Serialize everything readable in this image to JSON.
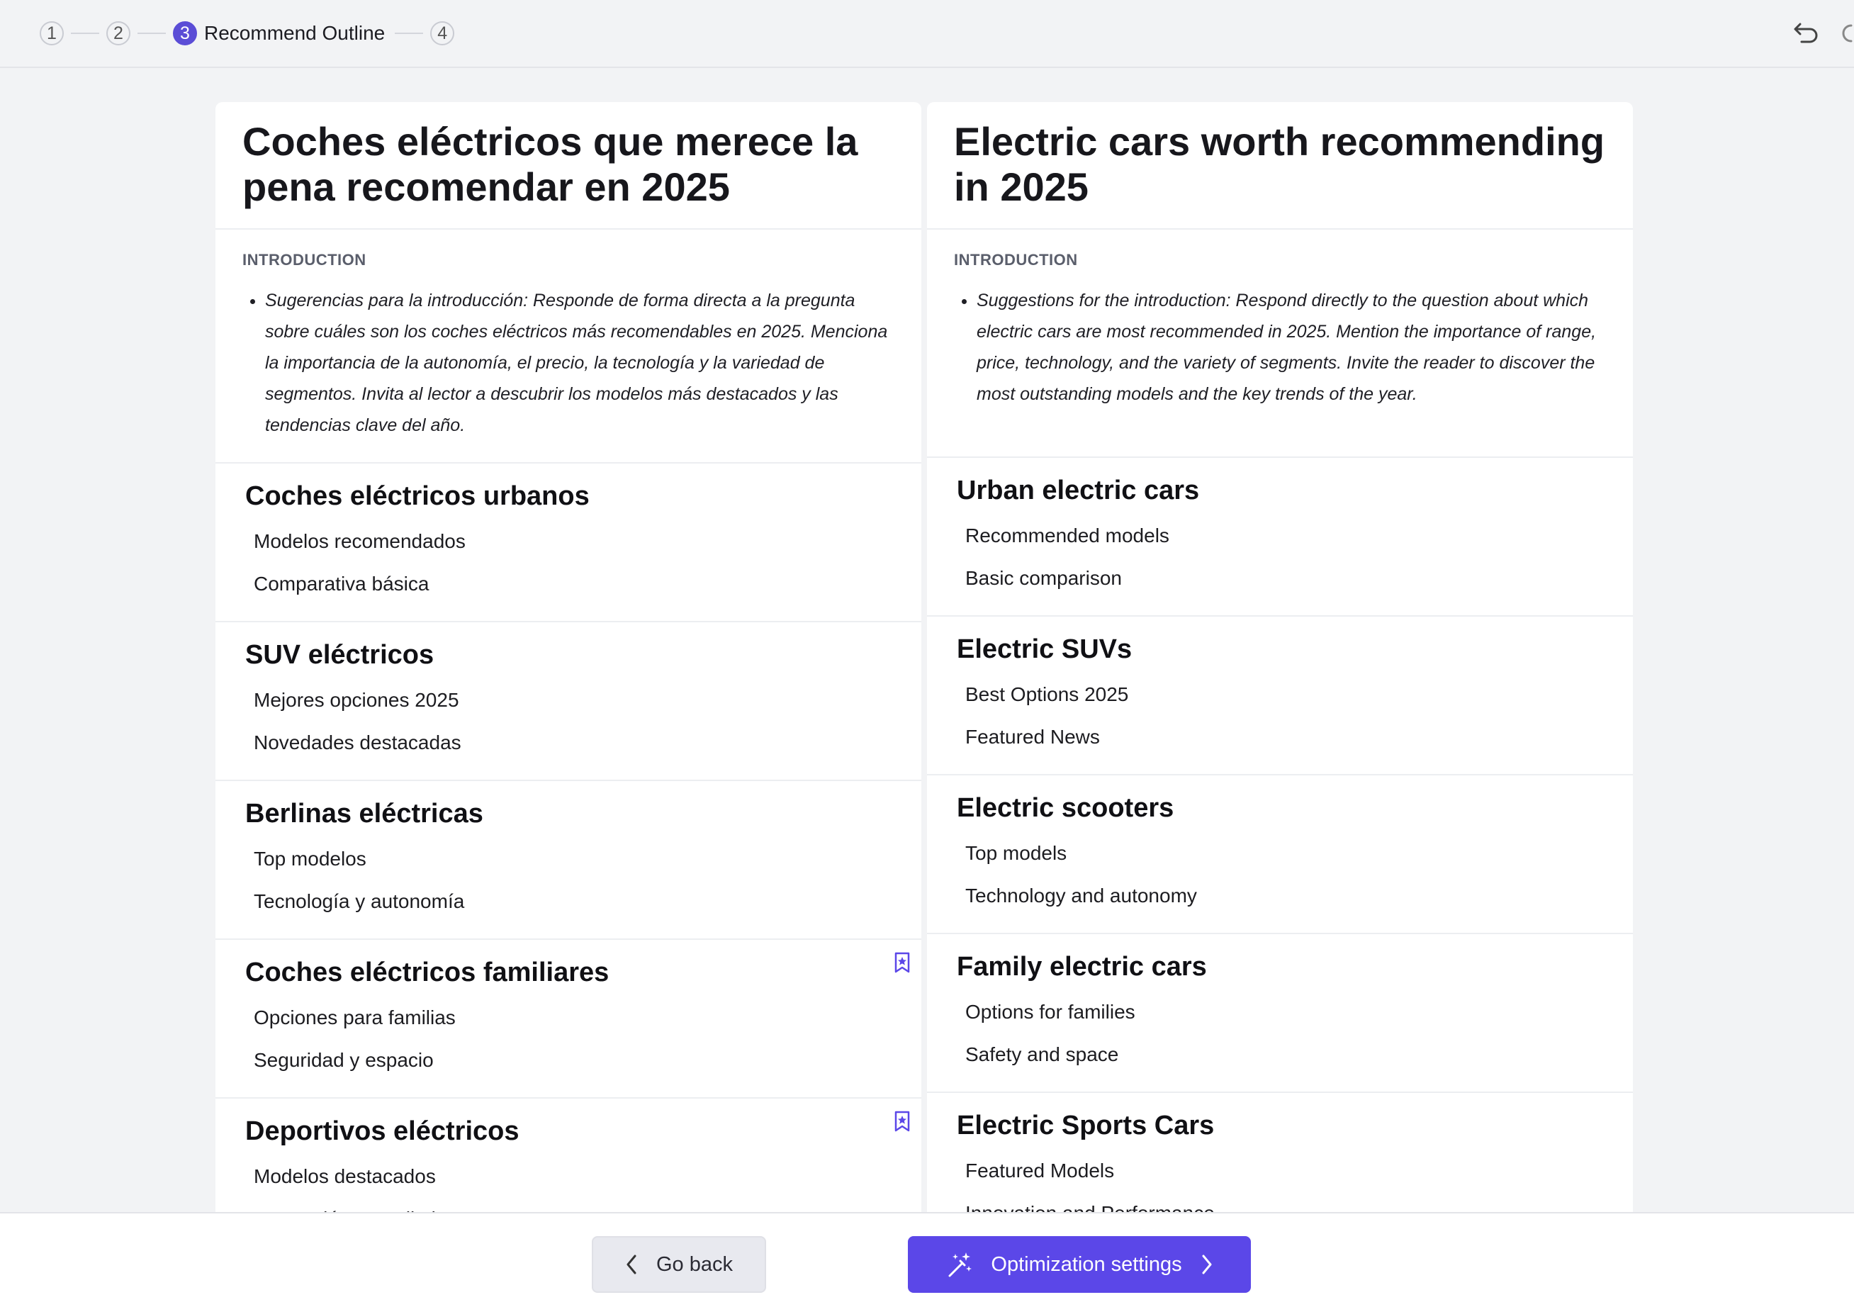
{
  "stepper": {
    "steps": [
      {
        "number": "1",
        "label": ""
      },
      {
        "number": "2",
        "label": ""
      },
      {
        "number": "3",
        "label": "Recommend Outline"
      },
      {
        "number": "4",
        "label": ""
      }
    ],
    "active_step": 3
  },
  "toolbar": {
    "undo_icon": "undo-icon",
    "redo_icon": "redo-icon"
  },
  "columns": [
    {
      "title": "Coches eléctricos que merece la pena recomendar en 2025",
      "intro_label": "INTRODUCTION",
      "intro_text": "Sugerencias para la introducción: Responde de forma directa a la pregunta sobre cuáles son los coches eléctricos más recomendables en 2025. Menciona la importancia de la autonomía, el precio, la tecnología y la variedad de segmentos. Invita al lector a descubrir los modelos más destacados y las tendencias clave del año.",
      "sections": [
        {
          "heading": "Coches eléctricos urbanos",
          "items": [
            "Modelos recomendados",
            "Comparativa básica"
          ],
          "bookmarked": false
        },
        {
          "heading": "SUV eléctricos",
          "items": [
            "Mejores opciones 2025",
            "Novedades destacadas"
          ],
          "bookmarked": false
        },
        {
          "heading": "Berlinas eléctricas",
          "items": [
            "Top modelos",
            "Tecnología y autonomía"
          ],
          "bookmarked": false
        },
        {
          "heading": "Coches eléctricos familiares",
          "items": [
            "Opciones para familias",
            "Seguridad y espacio"
          ],
          "bookmarked": true
        },
        {
          "heading": "Deportivos eléctricos",
          "items": [
            "Modelos destacados",
            "Innovación y rendimiento"
          ],
          "bookmarked": true
        }
      ]
    },
    {
      "title": "Electric cars worth recommending in 2025",
      "intro_label": "INTRODUCTION",
      "intro_text": "Suggestions for the introduction: Respond directly to the question about which electric cars are most recommended in 2025. Mention the importance of range, price, technology, and the variety of segments. Invite the reader to discover the most outstanding models and the key trends of the year.",
      "sections": [
        {
          "heading": "Urban electric cars",
          "items": [
            "Recommended models",
            "Basic comparison"
          ],
          "bookmarked": false
        },
        {
          "heading": "Electric SUVs",
          "items": [
            "Best Options 2025",
            "Featured News"
          ],
          "bookmarked": false
        },
        {
          "heading": "Electric scooters",
          "items": [
            "Top models",
            "Technology and autonomy"
          ],
          "bookmarked": false
        },
        {
          "heading": "Family electric cars",
          "items": [
            "Options for families",
            "Safety and space"
          ],
          "bookmarked": false
        },
        {
          "heading": "Electric Sports Cars",
          "items": [
            "Featured Models",
            "Innovation and Performance"
          ],
          "bookmarked": false
        }
      ]
    }
  ],
  "footer": {
    "back_label": "Go back",
    "next_label": "Optimization settings"
  },
  "colors": {
    "accent": "#5b47e8",
    "step_active": "#5b4dd6",
    "background": "#f2f3f5"
  }
}
